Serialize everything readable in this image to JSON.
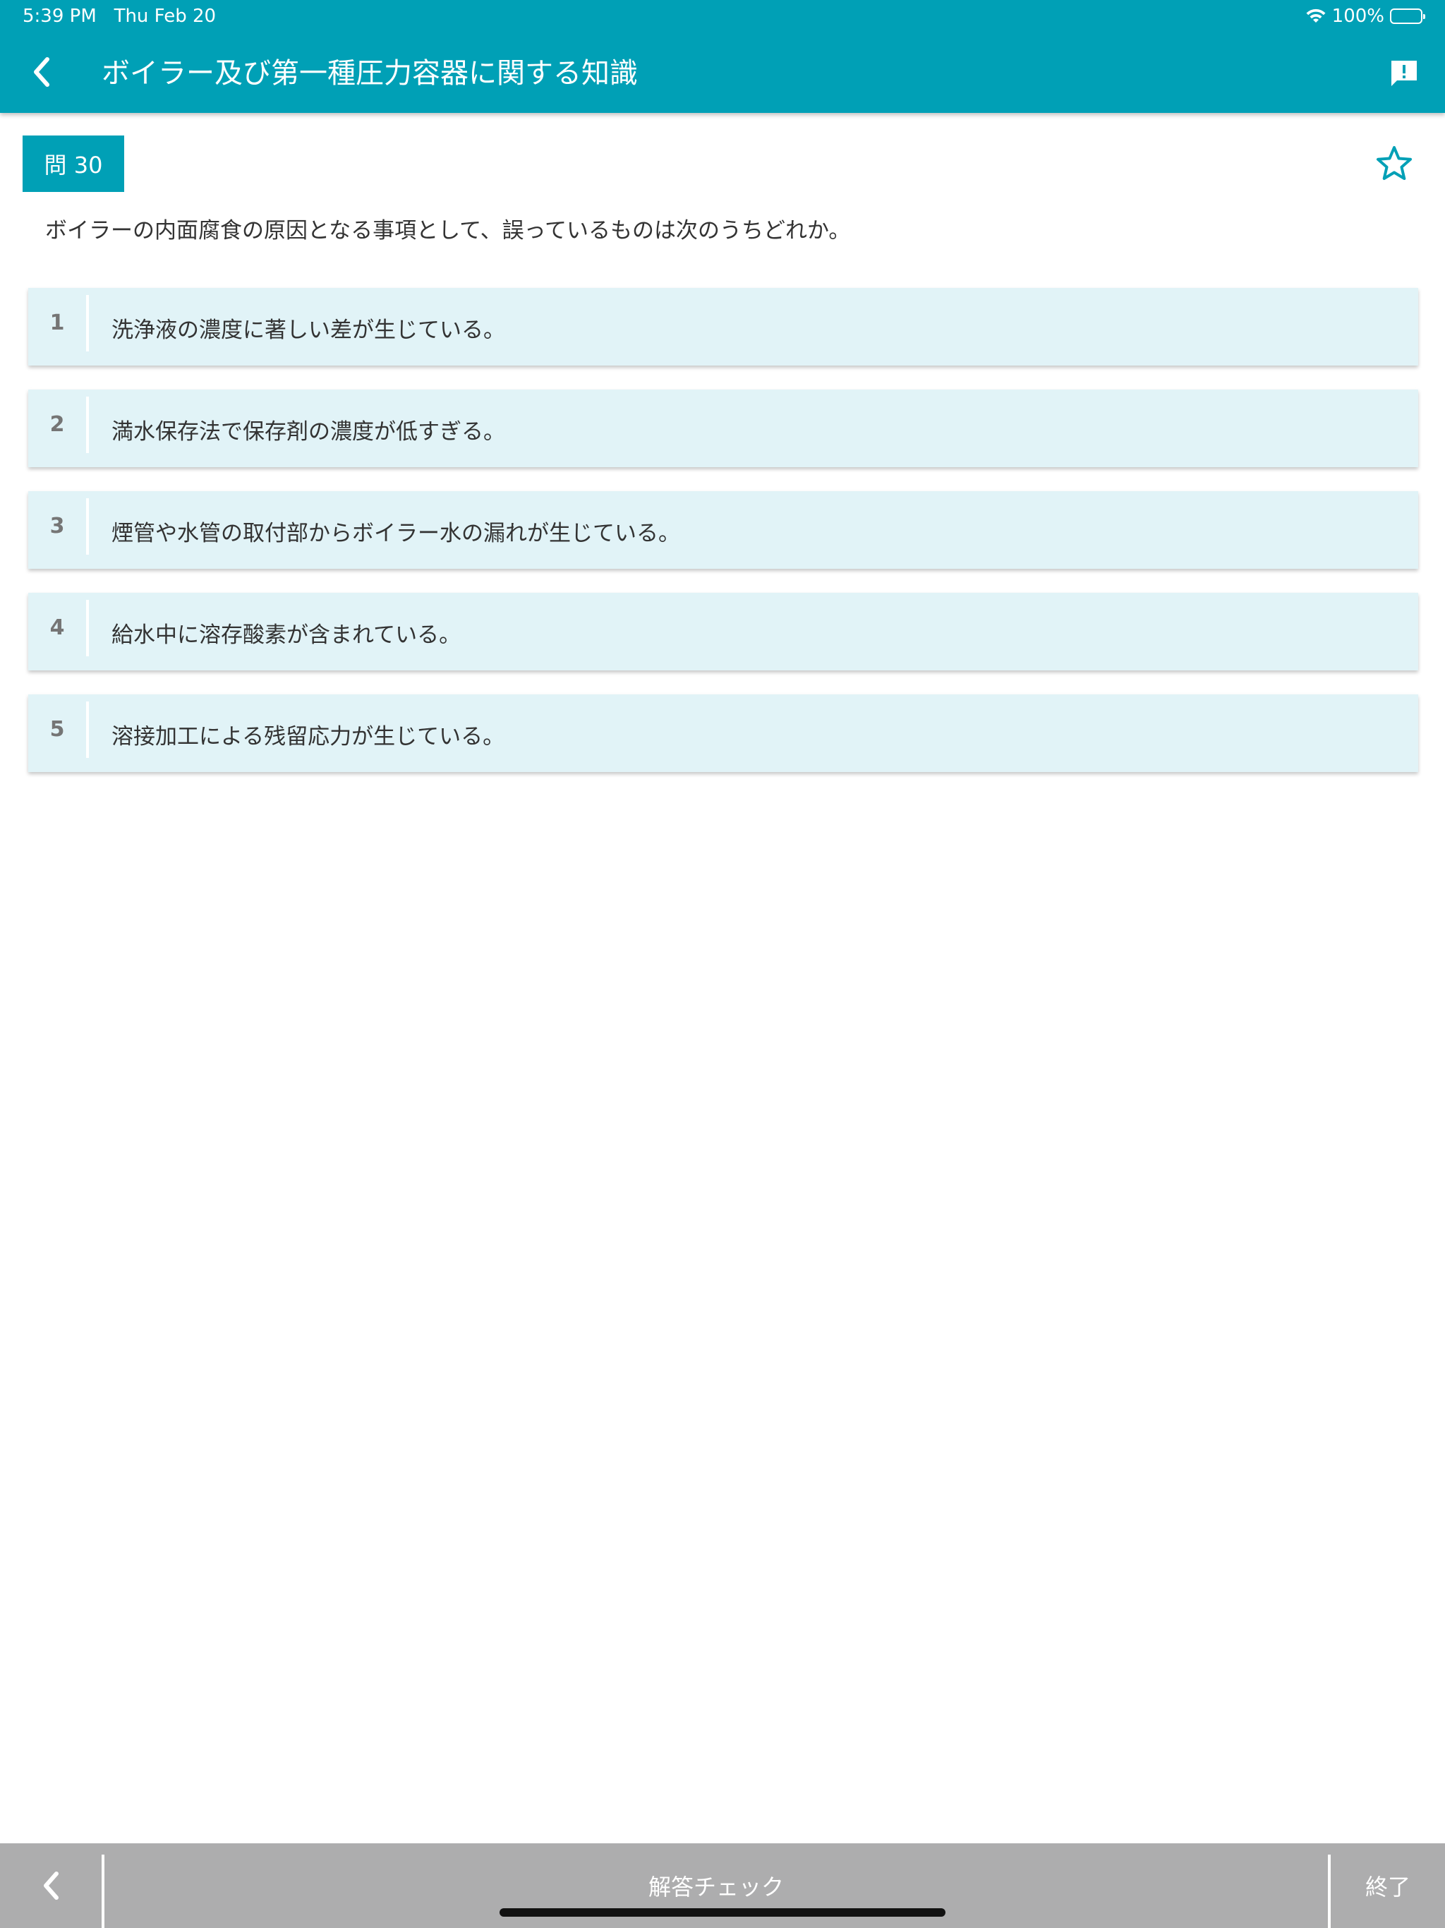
{
  "status_bar": {
    "time": "5:39 PM",
    "date": "Thu Feb 20",
    "battery": "100%"
  },
  "header": {
    "title": "ボイラー及び第一種圧力容器に関する知識"
  },
  "question": {
    "badge": "問 30",
    "text": "ボイラーの内面腐食の原因となる事項として、誤っているものは次のうちどれか。"
  },
  "choices": [
    {
      "num": "1",
      "text": "洗浄液の濃度に著しい差が生じている。"
    },
    {
      "num": "2",
      "text": "満水保存法で保存剤の濃度が低すぎる。"
    },
    {
      "num": "3",
      "text": "煙管や水管の取付部からボイラー水の漏れが生じている。"
    },
    {
      "num": "4",
      "text": "給水中に溶存酸素が含まれている。"
    },
    {
      "num": "5",
      "text": "溶接加工による残留応力が生じている。"
    }
  ],
  "footer": {
    "check_label": "解答チェック",
    "end_label": "終了"
  },
  "colors": {
    "accent": "#00a0b6",
    "choice_bg": "#e1f3f7",
    "footer_bg": "#adadae"
  },
  "icons": {
    "back": "chevron-left-icon",
    "report": "feedback-icon",
    "favorite": "star-outline-icon",
    "wifi": "wifi-icon",
    "battery": "battery-icon"
  }
}
